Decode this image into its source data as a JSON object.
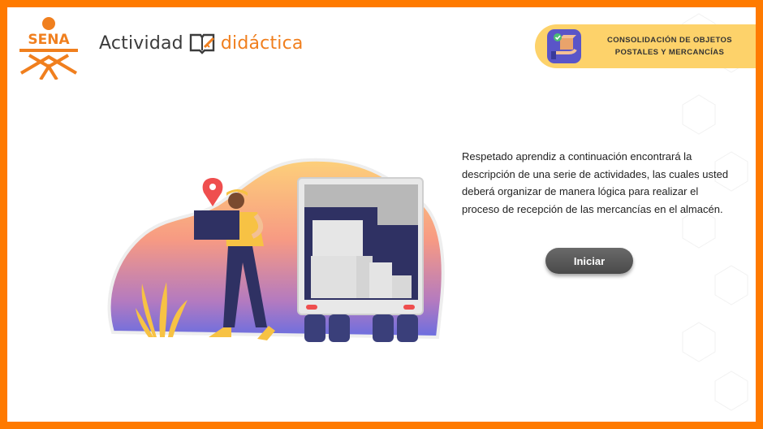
{
  "logo": {
    "text": "SENA",
    "color": "#f07f1e"
  },
  "brand": {
    "word1": "Actividad",
    "word2": "didáctica",
    "icon": "book-pencil-icon"
  },
  "badge": {
    "line1": "CONSOLIDACIÓN DE OBJETOS",
    "line2": "POSTALES Y MERCANCÍAS",
    "icon": "package-check-icon",
    "color": "#fdd26a"
  },
  "intro": {
    "text": "Respetado aprendiz a continuación encontrará la descripción de una serie de actividades, las cuales usted deberá organizar de manera lógica para realizar el proceso de recepción de las mercancías en el almacén."
  },
  "start_button": {
    "label": "Iniciar"
  },
  "colors": {
    "frame": "#ff7a00",
    "accent": "#f07f1e",
    "button": "#555555"
  }
}
